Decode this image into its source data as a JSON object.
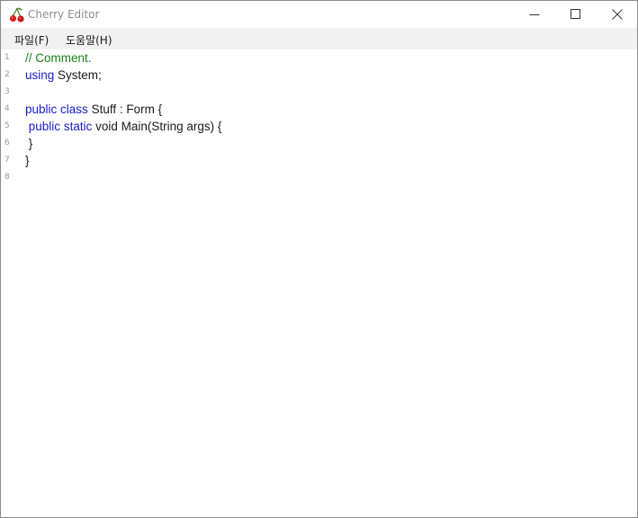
{
  "window": {
    "title": "Cherry Editor",
    "icon": "cherry-icon"
  },
  "controls": {
    "minimize_icon": "minimize-icon",
    "maximize_icon": "maximize-icon",
    "close_icon": "close-icon"
  },
  "menu": {
    "file": "파일(F)",
    "help": "도움말(H)"
  },
  "editor": {
    "line_numbers": [
      "1",
      "2",
      "3",
      "4",
      "5",
      "6",
      "7",
      "8"
    ],
    "lines": [
      [
        {
          "t": "// Comment.",
          "c": "cm"
        }
      ],
      [
        {
          "t": "using",
          "c": "kw"
        },
        {
          "t": " System;",
          "c": "tx"
        }
      ],
      [],
      [
        {
          "t": "public",
          "c": "kw"
        },
        {
          "t": " ",
          "c": "tx"
        },
        {
          "t": "class",
          "c": "kw"
        },
        {
          "t": " Stuff : Form {",
          "c": "tx"
        }
      ],
      [
        {
          "t": " ",
          "c": "tx"
        },
        {
          "t": "public",
          "c": "kw"
        },
        {
          "t": " ",
          "c": "tx"
        },
        {
          "t": "static",
          "c": "kw"
        },
        {
          "t": " void Main(String args) {",
          "c": "tx"
        }
      ],
      [
        {
          "t": " }",
          "c": "tx"
        }
      ],
      [
        {
          "t": "}",
          "c": "tx"
        }
      ],
      []
    ],
    "colors": {
      "comment": "#1a7f1a",
      "keyword": "#1a1acc",
      "text": "#1a1a1a",
      "line_number": "#9a9a9a"
    }
  }
}
